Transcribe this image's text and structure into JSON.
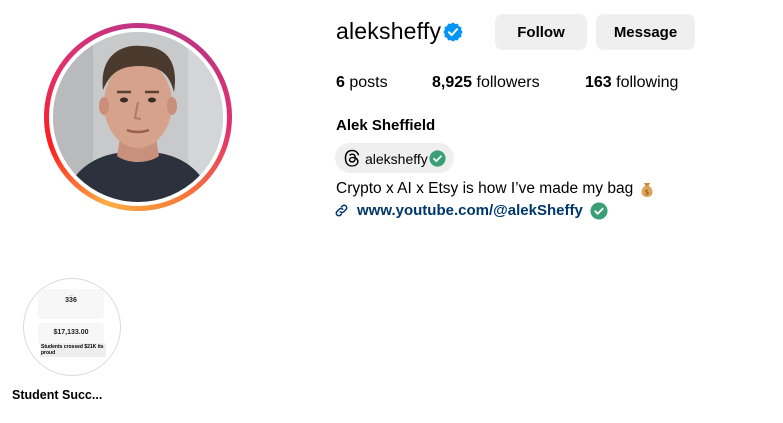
{
  "profile": {
    "username": "aleksheffy",
    "full_name": "Alek Sheffield",
    "verified": true
  },
  "actions": {
    "follow_label": "Follow",
    "message_label": "Message"
  },
  "stats": {
    "posts_count": "6",
    "posts_label": "posts",
    "followers_count": "8,925",
    "followers_label": "followers",
    "following_count": "163",
    "following_label": "following"
  },
  "threads": {
    "handle": "aleksheffy",
    "icon": "threads-icon"
  },
  "bio": {
    "text": "Crypto x AI x Etsy is how I’ve made my bag",
    "emoji_icon": "money-bag-icon",
    "link_text": "www.youtube.com/@alekSheffy"
  },
  "highlights": [
    {
      "label": "Student Succ...",
      "preview_number_1": "336",
      "preview_number_2": "$17,133.00",
      "preview_caption": "Students crossed $21K its proud"
    }
  ],
  "colors": {
    "verified_blue": "#0095f6",
    "check_green": "#3a9f77",
    "link_blue": "#00376b",
    "button_bg": "#efefef"
  }
}
